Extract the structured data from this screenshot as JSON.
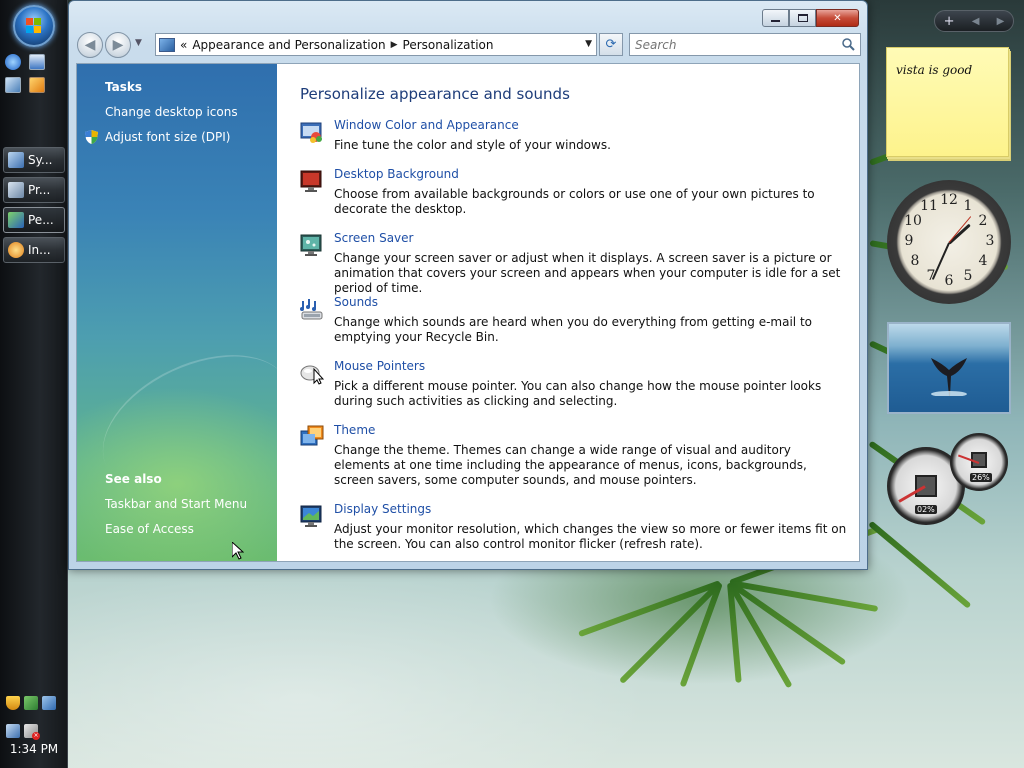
{
  "window": {
    "address": {
      "overflow": "«",
      "crumbs": [
        "Appearance and Personalization",
        "Personalization"
      ]
    },
    "search_placeholder": "Search",
    "tasks_pane": {
      "tasks_heading": "Tasks",
      "tasks": [
        "Change desktop icons",
        "Adjust font size (DPI)"
      ],
      "see_also_heading": "See also",
      "see_also": [
        "Taskbar and Start Menu",
        "Ease of Access"
      ]
    },
    "main": {
      "title": "Personalize appearance and sounds",
      "items": [
        {
          "icon": "window-color-icon",
          "link": "Window Color and Appearance",
          "description": "Fine tune the color and style of your windows."
        },
        {
          "icon": "desktop-background-icon",
          "link": "Desktop Background",
          "description": "Choose from available backgrounds or colors or use one of your own pictures to decorate the desktop."
        },
        {
          "icon": "screen-saver-icon",
          "link": "Screen Saver",
          "description": "Change your screen saver or adjust when it displays. A screen saver is a picture or animation that covers your screen and appears when your computer is idle for a set period of time."
        },
        {
          "icon": "sounds-icon",
          "link": "Sounds",
          "description": "Change which sounds are heard when you do everything from getting e-mail to emptying your Recycle Bin."
        },
        {
          "icon": "mouse-pointers-icon",
          "link": "Mouse Pointers",
          "description": "Pick a different mouse pointer. You can also change how the mouse pointer looks during such activities as clicking and selecting."
        },
        {
          "icon": "theme-icon",
          "link": "Theme",
          "description": "Change the theme. Themes can change a wide range of visual and auditory elements at one time including the appearance of menus, icons, backgrounds, screen savers, some computer sounds, and mouse pointers."
        },
        {
          "icon": "display-settings-icon",
          "link": "Display Settings",
          "description": "Adjust your monitor resolution, which changes the view so more or fewer items fit on the screen. You can also control monitor flicker (refresh rate)."
        }
      ]
    }
  },
  "taskbar": {
    "buttons": [
      {
        "label": "Sy...",
        "icon": "system-icon",
        "active": false
      },
      {
        "label": "Pr...",
        "icon": "program-icon",
        "active": false
      },
      {
        "label": "Pe...",
        "icon": "personalization-icon",
        "active": true
      },
      {
        "label": "In...",
        "icon": "internet-explorer-icon",
        "active": false
      }
    ],
    "clock": "1:34 PM"
  },
  "gadgets": {
    "sticky_note": "vista is good",
    "cpu_meter": "02%",
    "memory_meter": "26%"
  },
  "colors": {
    "link": "#1f4fa6",
    "title": "#1e3d7a",
    "tasks_pane_top": "#2f6fae",
    "tasks_pane_bottom": "#6bbc6f"
  }
}
